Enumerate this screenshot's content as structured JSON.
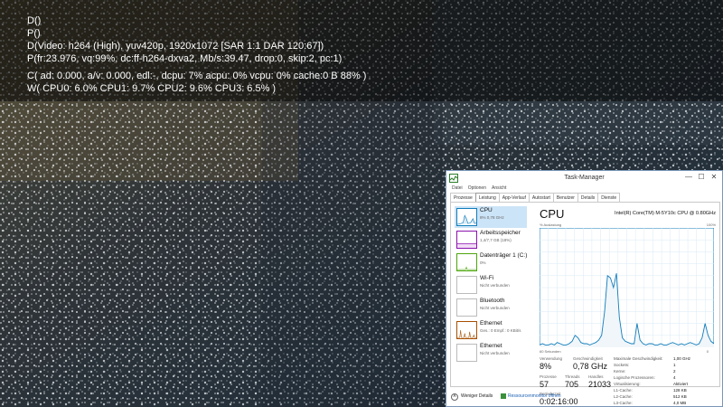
{
  "osd": {
    "lines": [
      "D()",
      "P()",
      "D(Video: h264 (High), yuv420p, 1920x1072 [SAR 1:1 DAR 120:67])",
      "P(fr:23.976, vq:99%, dc:ff-h264-dxva2, Mb/s:39.47, drop:0, skip:2, pc:1)",
      "C( ad: 0.000, a/v: 0.000, edl:-, dcpu: 7% acpu: 0% vcpu: 0% cache:0 B 88% )",
      "W( CPU0: 6.0% CPU1: 9.7% CPU2: 9.6% CPU3: 6.5% )"
    ]
  },
  "taskmanager": {
    "title": "Task-Manager",
    "window_controls": {
      "minimize": "—",
      "maximize": "☐",
      "close": "✕"
    },
    "menu": [
      "Datei",
      "Optionen",
      "Ansicht"
    ],
    "tabs": [
      "Prozesse",
      "Leistung",
      "App-Verlauf",
      "Autostart",
      "Benutzer",
      "Details",
      "Dienste"
    ],
    "active_tab": "Leistung",
    "sidebar": [
      {
        "label": "CPU",
        "sub": "8% 0,78 GHz",
        "color": "#117dbb"
      },
      {
        "label": "Arbeitsspeicher",
        "sub": "1,4/7,7 GB (18%)",
        "color": "#8b12ae"
      },
      {
        "label": "Datenträger 1 (C:)",
        "sub": "0%",
        "color": "#4da60c"
      },
      {
        "label": "Wi-Fi",
        "sub": "Nicht verbunden",
        "color": "#a74f01"
      },
      {
        "label": "Bluetooth",
        "sub": "Nicht verbunden",
        "color": "#a74f01"
      },
      {
        "label": "Ethernet",
        "sub": "Ges.: 0 Empf.: 0 KBit/s",
        "color": "#a74f01"
      },
      {
        "label": "Ethernet",
        "sub": "Nicht verbunden",
        "color": "#a74f01"
      }
    ],
    "main": {
      "title": "CPU",
      "cpu_name": "Intel(R) Core(TM) M-5Y10c CPU @ 0.80GHz",
      "graph_label_left": "% Auslastung",
      "graph_label_right": "100%",
      "graph_time_label": "60 Sekunden",
      "graph_zero_label": "0",
      "stats": {
        "verwendung_label": "Verwendung",
        "verwendung_value": "8%",
        "geschwindigkeit_label": "Geschwindigkeit",
        "geschwindigkeit_value": "0,78 GHz",
        "prozesse_label": "Prozesse",
        "prozesse_value": "57",
        "threads_label": "Threads",
        "threads_value": "705",
        "handles_label": "Handles",
        "handles_value": "21033",
        "betriebszeit_label": "Betriebszeit",
        "betriebszeit_value": "0:02:16:00"
      },
      "specs": [
        {
          "key": "Maximale Geschwindigkeit:",
          "value": "1,00 GHz"
        },
        {
          "key": "Sockets:",
          "value": "1"
        },
        {
          "key": "Kerne:",
          "value": "2"
        },
        {
          "key": "Logische Prozessoren:",
          "value": "4"
        },
        {
          "key": "Virtualisierung:",
          "value": "Aktiviert"
        },
        {
          "key": "L1-Cache:",
          "value": "128 KB"
        },
        {
          "key": "L2-Cache:",
          "value": "512 KB"
        },
        {
          "key": "L3-Cache:",
          "value": "4,0 MB"
        }
      ]
    },
    "footer": {
      "fewer_details": "Weniger Details",
      "resource_monitor": "Ressourcenmonitor öffnen",
      "link_color": "#1a5fb4"
    },
    "cpu_history_percent": [
      2,
      3,
      2,
      2,
      3,
      2,
      4,
      3,
      2,
      2,
      3,
      5,
      10,
      8,
      4,
      3,
      3,
      2,
      3,
      4,
      6,
      10,
      30,
      60,
      58,
      50,
      62,
      25,
      8,
      5,
      4,
      3,
      3,
      20,
      6,
      3,
      2,
      3,
      3,
      2,
      2,
      3,
      2,
      2,
      3,
      4,
      3,
      2,
      3,
      2,
      3,
      4,
      3,
      2,
      3,
      8,
      20,
      10,
      5,
      3
    ],
    "accent": "#117dbb"
  }
}
